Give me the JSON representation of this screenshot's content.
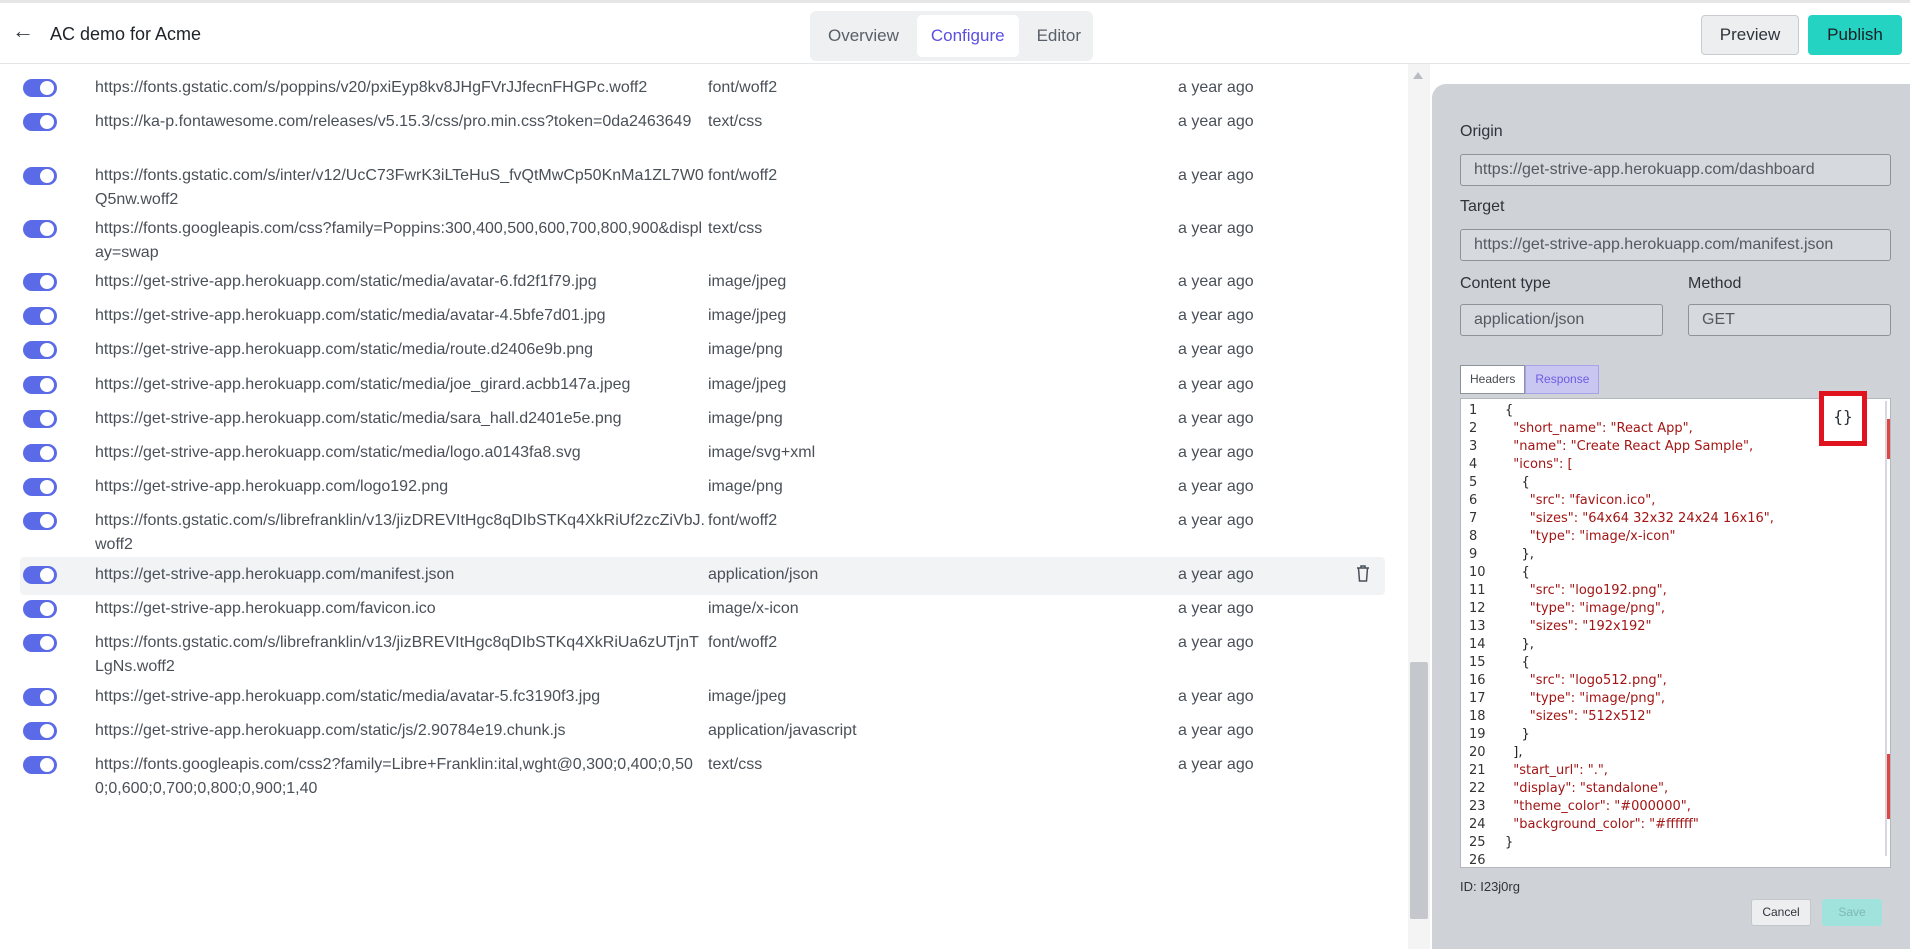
{
  "header": {
    "title": "AC demo for Acme",
    "tabs": [
      "Overview",
      "Configure",
      "Editor"
    ],
    "active_tab": "Configure",
    "preview_label": "Preview",
    "publish_label": "Publish"
  },
  "resources": [
    {
      "url": "https://fonts.gstatic.com/s/poppins/v20/pxiEyp8kv8JHgFVrJJfecnFHGPc.woff2",
      "type": "font/woff2",
      "time": "a year ago"
    },
    {
      "url": "https://ka-p.fontawesome.com/releases/v5.15.3/css/pro.min.css?token=0da2463649",
      "type": "text/css",
      "time": "a year ago"
    },
    {
      "url": "https://fonts.gstatic.com/s/inter/v12/UcC73FwrK3iLTeHuS_fvQtMwCp50KnMa1ZL7W0Q5nw.woff2",
      "type": "font/woff2",
      "time": "a year ago"
    },
    {
      "url": "https://fonts.googleapis.com/css?family=Poppins:300,400,500,600,700,800,900&display=swap",
      "type": "text/css",
      "time": "a year ago"
    },
    {
      "url": "https://get-strive-app.herokuapp.com/static/media/avatar-6.fd2f1f79.jpg",
      "type": "image/jpeg",
      "time": "a year ago"
    },
    {
      "url": "https://get-strive-app.herokuapp.com/static/media/avatar-4.5bfe7d01.jpg",
      "type": "image/jpeg",
      "time": "a year ago"
    },
    {
      "url": "https://get-strive-app.herokuapp.com/static/media/route.d2406e9b.png",
      "type": "image/png",
      "time": "a year ago"
    },
    {
      "url": "https://get-strive-app.herokuapp.com/static/media/joe_girard.acbb147a.jpeg",
      "type": "image/jpeg",
      "time": "a year ago"
    },
    {
      "url": "https://get-strive-app.herokuapp.com/static/media/sara_hall.d2401e5e.png",
      "type": "image/png",
      "time": "a year ago"
    },
    {
      "url": "https://get-strive-app.herokuapp.com/static/media/logo.a0143fa8.svg",
      "type": "image/svg+xml",
      "time": "a year ago"
    },
    {
      "url": "https://get-strive-app.herokuapp.com/logo192.png",
      "type": "image/png",
      "time": "a year ago"
    },
    {
      "url": "https://fonts.gstatic.com/s/librefranklin/v13/jizDREVItHgc8qDIbSTKq4XkRiUf2zcZiVbJ.woff2",
      "type": "font/woff2",
      "time": "a year ago"
    },
    {
      "url": "https://get-strive-app.herokuapp.com/manifest.json",
      "type": "application/json",
      "time": "a year ago"
    },
    {
      "url": "https://get-strive-app.herokuapp.com/favicon.ico",
      "type": "image/x-icon",
      "time": "a year ago"
    },
    {
      "url": "https://fonts.gstatic.com/s/librefranklin/v13/jizBREVItHgc8qDIbSTKq4XkRiUa6zUTjnTLgNs.woff2",
      "type": "font/woff2",
      "time": "a year ago"
    },
    {
      "url": "https://get-strive-app.herokuapp.com/static/media/avatar-5.fc3190f3.jpg",
      "type": "image/jpeg",
      "time": "a year ago"
    },
    {
      "url": "https://get-strive-app.herokuapp.com/static/js/2.90784e19.chunk.js",
      "type": "application/javascript",
      "time": "a year ago"
    },
    {
      "url": "https://fonts.googleapis.com/css2?family=Libre+Franklin:ital,wght@0,300;0,400;0,500;0,600;0,700;0,800;0,900;1,40",
      "type": "text/css",
      "time": "a year ago"
    }
  ],
  "selected_row": 12,
  "detail": {
    "origin_label": "Origin",
    "origin_value": "https://get-strive-app.herokuapp.com/dashboard",
    "target_label": "Target",
    "target_value": "https://get-strive-app.herokuapp.com/manifest.json",
    "content_type_label": "Content type",
    "content_type_value": "application/json",
    "method_label": "Method",
    "method_value": "GET",
    "subtabs": [
      "Headers",
      "Response"
    ],
    "active_subtab": "Response",
    "format_button": "{}",
    "id_text": "ID: I23j0rg",
    "cancel_label": "Cancel",
    "save_label": "Save",
    "code_lines": [
      "{",
      "  \"short_name\": \"React App\",",
      "  \"name\": \"Create React App Sample\",",
      "  \"icons\": [",
      "    {",
      "      \"src\": \"favicon.ico\",",
      "      \"sizes\": \"64x64 32x32 24x24 16x16\",",
      "      \"type\": \"image/x-icon\"",
      "    },",
      "    {",
      "      \"src\": \"logo192.png\",",
      "      \"type\": \"image/png\",",
      "      \"sizes\": \"192x192\"",
      "    },",
      "    {",
      "      \"src\": \"logo512.png\",",
      "      \"type\": \"image/png\",",
      "      \"sizes\": \"512x512\"",
      "    }",
      "  ],",
      "  \"start_url\": \".\",",
      "  \"display\": \"standalone\",",
      "  \"theme_color\": \"#000000\",",
      "  \"background_color\": \"#ffffff\"",
      "}",
      ""
    ]
  },
  "colors": {
    "accent": "#5b4fe0",
    "publish": "#25d3c3",
    "toggle": "#5b6be8",
    "highlight_box": "#e0141e"
  }
}
